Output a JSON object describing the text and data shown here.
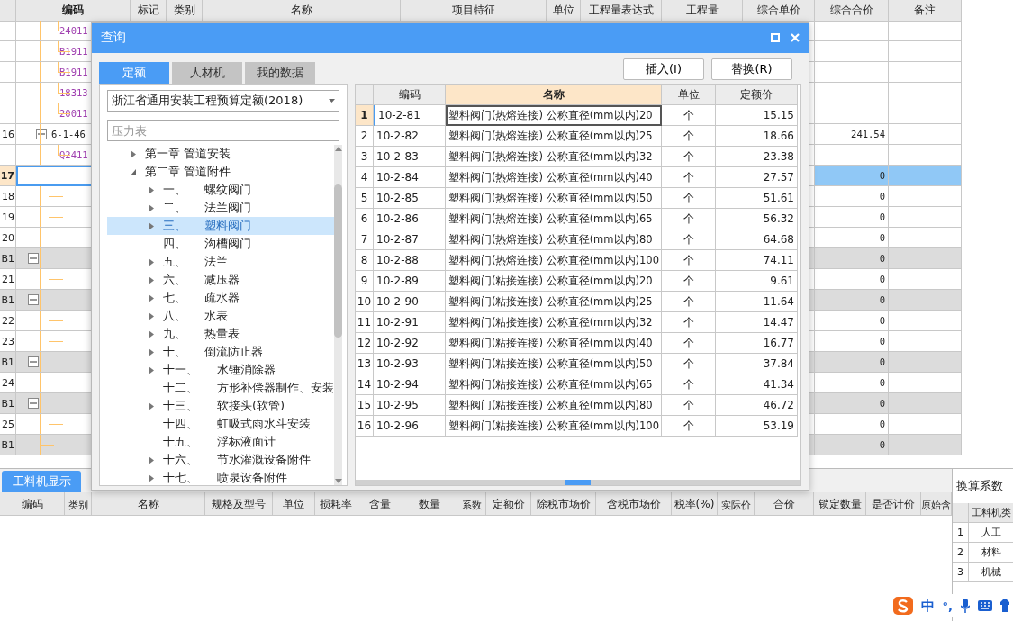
{
  "main_table": {
    "columns": [
      "编码",
      "标记",
      "类别",
      "名称",
      "项目特征",
      "单位",
      "工程量表达式",
      "工程量",
      "综合单价",
      "综合合价",
      "备注"
    ],
    "rows": [
      {
        "code": "24011",
        "kind": "child",
        "selected": false
      },
      {
        "code": "B1911",
        "kind": "child",
        "selected": false
      },
      {
        "code": "B1911",
        "kind": "child",
        "selected": false
      },
      {
        "code": "18313",
        "kind": "child",
        "selected": false
      },
      {
        "code": "20011",
        "kind": "child",
        "selected": false
      },
      {
        "number": "16",
        "code": "6-1-46",
        "kind": "parent",
        "expanded": true,
        "total": "241.54",
        "selected": false
      },
      {
        "code": "Q2411",
        "kind": "child",
        "selected": false
      },
      {
        "number": "17",
        "kind": "blank",
        "total": "0",
        "selected": true
      },
      {
        "number": "18",
        "kind": "branch",
        "total": "0",
        "selected": false
      },
      {
        "number": "19",
        "kind": "branch",
        "total": "0",
        "selected": false
      },
      {
        "number": "20",
        "kind": "branch",
        "total": "0",
        "selected": false
      },
      {
        "number": "B1",
        "kind": "group",
        "expanded": true,
        "total": "0",
        "selected": false
      },
      {
        "number": "21",
        "kind": "branch",
        "total": "0",
        "selected": false
      },
      {
        "number": "B1",
        "kind": "group",
        "expanded": true,
        "total": "0",
        "selected": false
      },
      {
        "number": "22",
        "kind": "branch",
        "total": "0",
        "selected": false
      },
      {
        "number": "23",
        "kind": "branch",
        "total": "0",
        "selected": false
      },
      {
        "number": "B1",
        "kind": "group",
        "expanded": true,
        "total": "0",
        "selected": false
      },
      {
        "number": "24",
        "kind": "branch",
        "total": "0",
        "selected": false
      },
      {
        "number": "B1",
        "kind": "group",
        "expanded": true,
        "total": "0",
        "selected": false
      },
      {
        "number": "25",
        "kind": "branch",
        "total": "0",
        "selected": false
      },
      {
        "number": "B1",
        "kind": "group",
        "total": "0",
        "selected": false
      }
    ]
  },
  "dialog": {
    "title": "查询",
    "tabs": [
      {
        "label": "定额",
        "selected": true
      },
      {
        "label": "人材机",
        "selected": false
      },
      {
        "label": "我的数据",
        "selected": false
      }
    ],
    "buttons": [
      "插入(I)",
      "替换(R)"
    ],
    "library": "浙江省通用安装工程预算定额(2018)",
    "search": {
      "placeholder": "压力表"
    },
    "tree": [
      {
        "label": "第一章 管道安装",
        "expanded": false,
        "selected": false
      },
      {
        "label": "第二章 管道附件",
        "expanded": true,
        "selected": false,
        "children": [
          {
            "number": "一、",
            "name": "螺纹阀门",
            "expanded": false,
            "selected": false
          },
          {
            "number": "二、",
            "name": "法兰阀门",
            "expanded": false,
            "selected": false
          },
          {
            "number": "三、",
            "name": "塑料阀门",
            "expanded": false,
            "selected": true
          },
          {
            "number": "四、",
            "name": "沟槽阀门",
            "selected": false
          },
          {
            "number": "五、",
            "name": "法兰",
            "expanded": false,
            "selected": false
          },
          {
            "number": "六、",
            "name": "减压器",
            "expanded": false,
            "selected": false
          },
          {
            "number": "七、",
            "name": "疏水器",
            "expanded": false,
            "selected": false
          },
          {
            "number": "八、",
            "name": "水表",
            "expanded": false,
            "selected": false
          },
          {
            "number": "九、",
            "name": "热量表",
            "expanded": false,
            "selected": false
          },
          {
            "number": "十、",
            "name": "倒流防止器",
            "expanded": false,
            "selected": false
          },
          {
            "number": "十一、",
            "name": "水锤消除器",
            "expanded": false,
            "selected": false
          },
          {
            "number": "十二、",
            "name": "方形补偿器制作、安装",
            "selected": false
          },
          {
            "number": "十三、",
            "name": "软接头(软管)",
            "expanded": false,
            "selected": false
          },
          {
            "number": "十四、",
            "name": "虹吸式雨水斗安装",
            "selected": false
          },
          {
            "number": "十五、",
            "name": "浮标液面计",
            "selected": false
          },
          {
            "number": "十六、",
            "name": "节水灌溉设备附件",
            "expanded": false,
            "selected": false
          },
          {
            "number": "十七、",
            "name": "喷泉设备附件",
            "expanded": false,
            "selected": false
          }
        ]
      }
    ],
    "table": {
      "columns": [
        "编码",
        "名称",
        "单位",
        "定额价"
      ],
      "rows": [
        {
          "number": "1",
          "code": "10-2-81",
          "name": "塑料阀门(热熔连接) 公称直径(mm以内)20",
          "unit": "个",
          "price": "15.15",
          "selected": true
        },
        {
          "number": "2",
          "code": "10-2-82",
          "name": "塑料阀门(热熔连接) 公称直径(mm以内)25",
          "unit": "个",
          "price": "18.66",
          "selected": false
        },
        {
          "number": "3",
          "code": "10-2-83",
          "name": "塑料阀门(热熔连接) 公称直径(mm以内)32",
          "unit": "个",
          "price": "23.38",
          "selected": false
        },
        {
          "number": "4",
          "code": "10-2-84",
          "name": "塑料阀门(热熔连接) 公称直径(mm以内)40",
          "unit": "个",
          "price": "27.57",
          "selected": false
        },
        {
          "number": "5",
          "code": "10-2-85",
          "name": "塑料阀门(热熔连接) 公称直径(mm以内)50",
          "unit": "个",
          "price": "51.61",
          "selected": false
        },
        {
          "number": "6",
          "code": "10-2-86",
          "name": "塑料阀门(热熔连接) 公称直径(mm以内)65",
          "unit": "个",
          "price": "56.32",
          "selected": false
        },
        {
          "number": "7",
          "code": "10-2-87",
          "name": "塑料阀门(热熔连接) 公称直径(mm以内)80",
          "unit": "个",
          "price": "64.68",
          "selected": false
        },
        {
          "number": "8",
          "code": "10-2-88",
          "name": "塑料阀门(热熔连接) 公称直径(mm以内)100",
          "unit": "个",
          "price": "74.11",
          "selected": false
        },
        {
          "number": "9",
          "code": "10-2-89",
          "name": "塑料阀门(粘接连接) 公称直径(mm以内)20",
          "unit": "个",
          "price": "9.61",
          "selected": false
        },
        {
          "number": "10",
          "code": "10-2-90",
          "name": "塑料阀门(粘接连接) 公称直径(mm以内)25",
          "unit": "个",
          "price": "11.64",
          "selected": false
        },
        {
          "number": "11",
          "code": "10-2-91",
          "name": "塑料阀门(粘接连接) 公称直径(mm以内)32",
          "unit": "个",
          "price": "14.47",
          "selected": false
        },
        {
          "number": "12",
          "code": "10-2-92",
          "name": "塑料阀门(粘接连接) 公称直径(mm以内)40",
          "unit": "个",
          "price": "16.77",
          "selected": false
        },
        {
          "number": "13",
          "code": "10-2-93",
          "name": "塑料阀门(粘接连接) 公称直径(mm以内)50",
          "unit": "个",
          "price": "37.84",
          "selected": false
        },
        {
          "number": "14",
          "code": "10-2-94",
          "name": "塑料阀门(粘接连接) 公称直径(mm以内)65",
          "unit": "个",
          "price": "41.34",
          "selected": false
        },
        {
          "number": "15",
          "code": "10-2-95",
          "name": "塑料阀门(粘接连接) 公称直径(mm以内)80",
          "unit": "个",
          "price": "46.72",
          "selected": false
        },
        {
          "number": "16",
          "code": "10-2-96",
          "name": "塑料阀门(粘接连接) 公称直径(mm以内)100",
          "unit": "个",
          "price": "53.19",
          "selected": false
        }
      ]
    }
  },
  "bottom": {
    "tabs": [
      {
        "label": "工料机显示",
        "selected": true
      }
    ],
    "columns": [
      "编码",
      "类别",
      "名称",
      "规格及型号",
      "单位",
      "损耗率",
      "含量",
      "数量",
      "系数",
      "定额价",
      "除税市场价",
      "含税市场价",
      "税率(%)",
      "实际价",
      "合价",
      "锁定数量",
      "是否计价",
      "原始含"
    ],
    "side_panel": {
      "title": "换算系数",
      "columns": [
        "工料机类"
      ],
      "rows": [
        {
          "number": "1",
          "type": "人工"
        },
        {
          "number": "2",
          "type": "材料"
        },
        {
          "number": "3",
          "type": "机械"
        }
      ]
    }
  },
  "ime_bar": {
    "mode": "中",
    "punctuation": "°,"
  }
}
